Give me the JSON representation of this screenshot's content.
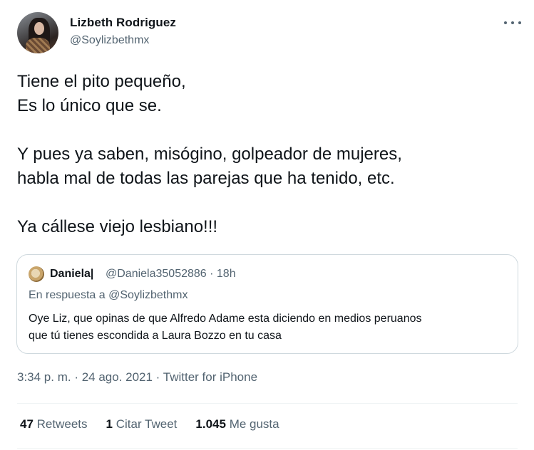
{
  "author": {
    "name": "Lizbeth Rodriguez",
    "handle": "@Soylizbethmx"
  },
  "tweet": {
    "lines": [
      "Tiene el pito pequeño,",
      "Es lo único que se.",
      "",
      "Y pues ya saben, misógino, golpeador de mujeres,",
      "habla mal de todas las parejas que ha tenido, etc.",
      "",
      "Ya cállese viejo lesbiano!!!"
    ]
  },
  "quoted": {
    "name": "Daniela|",
    "handle_time": "@Daniela35052886 · 18h",
    "reply_to": "En respuesta a @Soylizbethmx",
    "lines": [
      "Oye Liz, que opinas de que Alfredo Adame esta diciendo en medios peruanos",
      "que tú tienes escondida a Laura Bozzo en tu casa"
    ]
  },
  "meta": {
    "time_date": "3:34 p. m. · 24 ago. 2021 · ",
    "source": "Twitter for iPhone"
  },
  "stats": {
    "retweets_count": "47",
    "retweets_label": "Retweets",
    "quotes_count": "1",
    "quotes_label": "Citar Tweet",
    "likes_count": "1.045",
    "likes_label": "Me gusta"
  },
  "icons": {
    "more": "more-horizontal-icon"
  }
}
